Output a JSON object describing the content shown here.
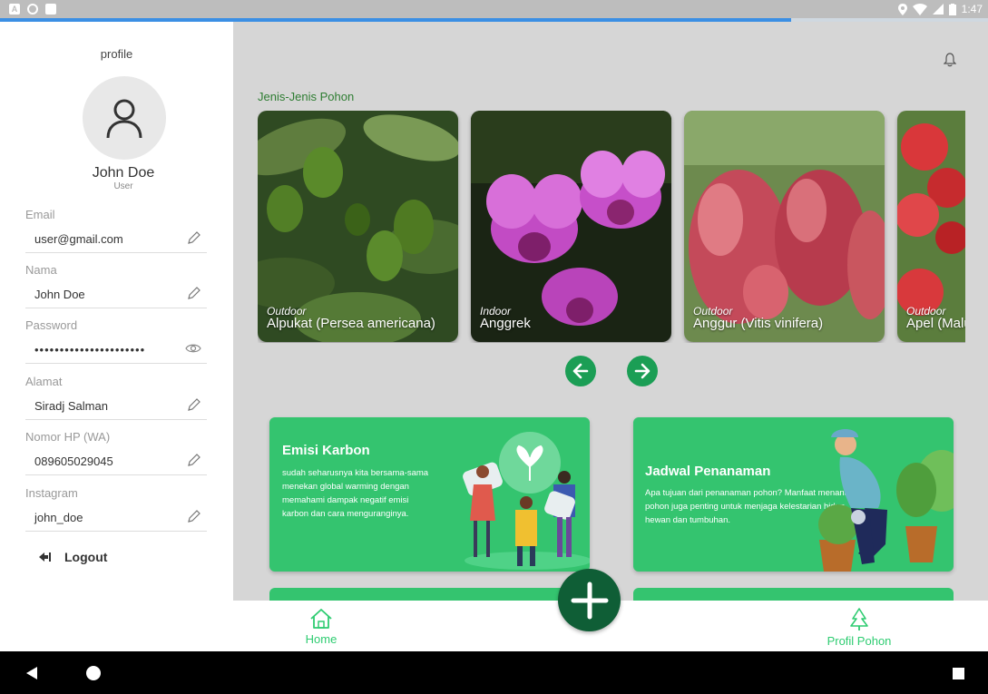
{
  "statusbar": {
    "time": "1:47"
  },
  "sidebar": {
    "title": "profile",
    "user_name": "John Doe",
    "user_role": "User",
    "fields": [
      {
        "label": "Email",
        "value": "user@gmail.com"
      },
      {
        "label": "Nama",
        "value": "John Doe"
      },
      {
        "label": "Password",
        "value": "••••••••••••••••••••••"
      },
      {
        "label": "Alamat",
        "value": "Siradj Salman"
      },
      {
        "label": "Nomor HP (WA)",
        "value": "089605029045"
      },
      {
        "label": "Instagram",
        "value": "john_doe"
      }
    ],
    "logout_label": "Logout"
  },
  "main": {
    "section_title": "Jenis-Jenis Pohon",
    "trees": [
      {
        "category": "Outdoor",
        "name": "Alpukat (Persea americana)"
      },
      {
        "category": "Indoor",
        "name": "Anggrek"
      },
      {
        "category": "Outdoor",
        "name": "Anggur (Vitis vinifera)"
      },
      {
        "category": "Outdoor",
        "name": "Apel (Malus domestica)"
      }
    ],
    "info_cards": [
      {
        "title": "Emisi Karbon",
        "text": "sudah seharusnya kita bersama-sama menekan global warming dengan memahami dampak negatif emisi karbon dan cara menguranginya."
      },
      {
        "title": "Jadwal Penanaman",
        "text": "Apa tujuan dari penanaman pohon? Manfaat menanam pohon juga penting untuk menjaga kelestarian hidup hewan dan tumbuhan."
      }
    ]
  },
  "bottom_nav": {
    "home_label": "Home",
    "profile_label": "Profil Pohon"
  },
  "colors": {
    "primary": "#34c46f",
    "dark_green": "#0f5e36",
    "nav_green": "#2ecc71"
  }
}
